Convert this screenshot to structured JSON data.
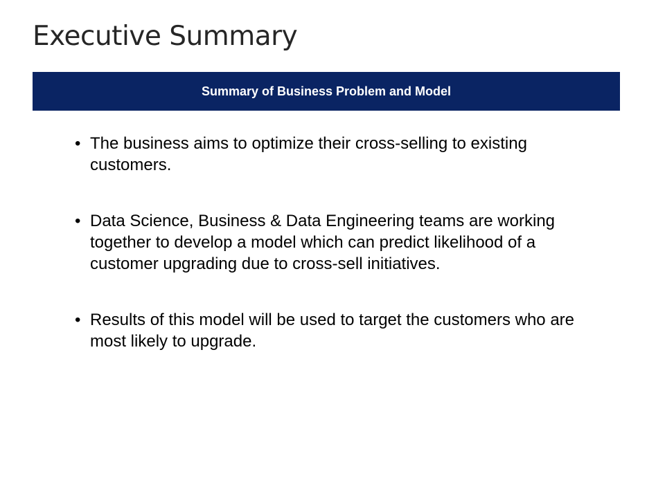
{
  "slide": {
    "title": "Executive Summary",
    "banner": "Summary of Business Problem and Model",
    "bullet_char": "•",
    "bullets": [
      "The business aims to optimize their cross-selling to existing customers.",
      "Data Science, Business & Data Engineering teams are working together to develop a model which can predict likelihood of a customer upgrading due to cross-sell initiatives.",
      "Results of this model will be used to target the customers who are most likely to upgrade."
    ]
  },
  "colors": {
    "banner_background": "#0a2463",
    "banner_text": "#ffffff",
    "title_text": "#262626"
  }
}
